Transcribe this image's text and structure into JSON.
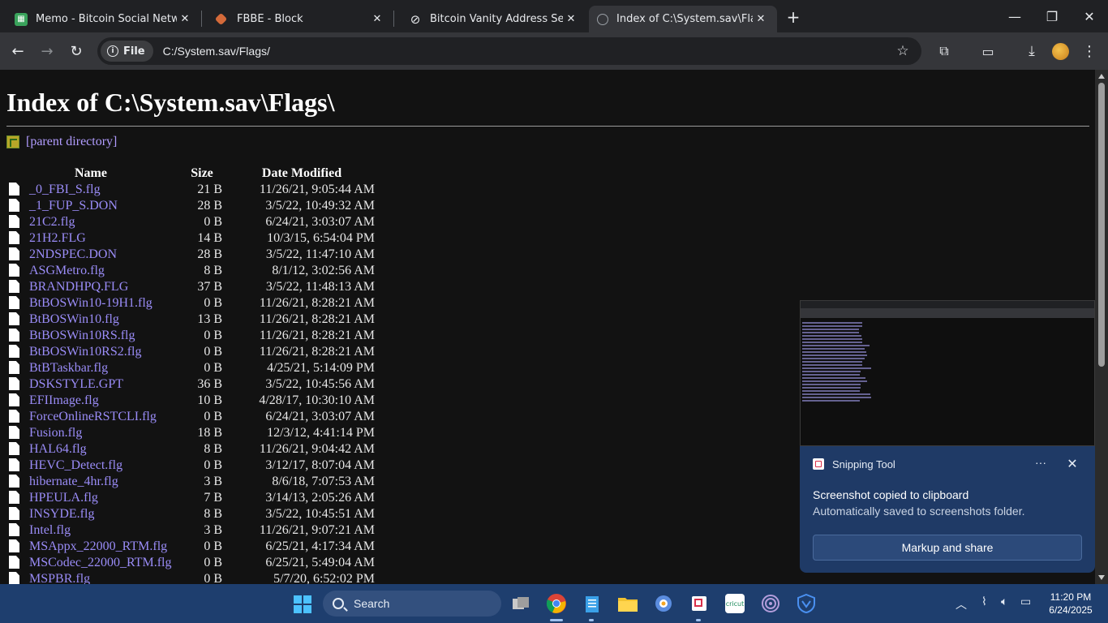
{
  "tabs": [
    {
      "title": "Memo - Bitcoin Social Network",
      "favicon": "memo-icon",
      "color": "#3aa35c"
    },
    {
      "title": "FBBE - Block",
      "favicon": "fbbe-icon",
      "color": "#d46a3a"
    },
    {
      "title": "Bitcoin Vanity Address Security",
      "favicon": "no-symbol-icon",
      "color": "#e8eaed"
    },
    {
      "title": "Index of C:\\System.sav\\Flags\\",
      "favicon": "globe-icon",
      "color": "#9aa0a6"
    }
  ],
  "address": {
    "chip_label": "File",
    "url": "C:/System.sav/Flags/"
  },
  "page": {
    "heading": "Index of C:\\System.sav\\Flags\\",
    "parent_link": "[parent directory]",
    "columns": {
      "name": "Name",
      "size": "Size",
      "date": "Date Modified"
    },
    "files": [
      {
        "name": "_0_FBI_S.flg",
        "size": "21 B",
        "date": "11/26/21, 9:05:44 AM"
      },
      {
        "name": "_1_FUP_S.DON",
        "size": "28 B",
        "date": "3/5/22, 10:49:32 AM"
      },
      {
        "name": "21C2.flg",
        "size": "0 B",
        "date": "6/24/21, 3:03:07 AM"
      },
      {
        "name": "21H2.FLG",
        "size": "14 B",
        "date": "10/3/15, 6:54:04 PM"
      },
      {
        "name": "2NDSPEC.DON",
        "size": "28 B",
        "date": "3/5/22, 11:47:10 AM"
      },
      {
        "name": "ASGMetro.flg",
        "size": "8 B",
        "date": "8/1/12, 3:02:56 AM"
      },
      {
        "name": "BRANDHPQ.FLG",
        "size": "37 B",
        "date": "3/5/22, 11:48:13 AM"
      },
      {
        "name": "BtBOSWin10-19H1.flg",
        "size": "0 B",
        "date": "11/26/21, 8:28:21 AM"
      },
      {
        "name": "BtBOSWin10.flg",
        "size": "13 B",
        "date": "11/26/21, 8:28:21 AM"
      },
      {
        "name": "BtBOSWin10RS.flg",
        "size": "0 B",
        "date": "11/26/21, 8:28:21 AM"
      },
      {
        "name": "BtBOSWin10RS2.flg",
        "size": "0 B",
        "date": "11/26/21, 8:28:21 AM"
      },
      {
        "name": "BtBTaskbar.flg",
        "size": "0 B",
        "date": "4/25/21, 5:14:09 PM"
      },
      {
        "name": "DSKSTYLE.GPT",
        "size": "36 B",
        "date": "3/5/22, 10:45:56 AM"
      },
      {
        "name": "EFIImage.flg",
        "size": "10 B",
        "date": "4/28/17, 10:30:10 AM"
      },
      {
        "name": "ForceOnlineRSTCLI.flg",
        "size": "0 B",
        "date": "6/24/21, 3:03:07 AM"
      },
      {
        "name": "Fusion.flg",
        "size": "18 B",
        "date": "12/3/12, 4:41:14 PM"
      },
      {
        "name": "HAL64.flg",
        "size": "8 B",
        "date": "11/26/21, 9:04:42 AM"
      },
      {
        "name": "HEVC_Detect.flg",
        "size": "0 B",
        "date": "3/12/17, 8:07:04 AM"
      },
      {
        "name": "hibernate_4hr.flg",
        "size": "3 B",
        "date": "8/6/18, 7:07:53 AM"
      },
      {
        "name": "HPEULA.flg",
        "size": "7 B",
        "date": "3/14/13, 2:05:26 AM"
      },
      {
        "name": "INSYDE.flg",
        "size": "8 B",
        "date": "3/5/22, 10:45:51 AM"
      },
      {
        "name": "Intel.flg",
        "size": "3 B",
        "date": "11/26/21, 9:07:21 AM"
      },
      {
        "name": "MSAppx_22000_RTM.flg",
        "size": "0 B",
        "date": "6/25/21, 4:17:34 AM"
      },
      {
        "name": "MSCodec_22000_RTM.flg",
        "size": "0 B",
        "date": "6/25/21, 5:49:04 AM"
      },
      {
        "name": "MSPBR.flg",
        "size": "0 B",
        "date": "5/7/20, 6:52:02 PM"
      }
    ]
  },
  "toast": {
    "app": "Snipping Tool",
    "more": "···",
    "heading": "Screenshot copied to clipboard",
    "body": "Automatically saved to screenshots folder.",
    "button": "Markup and share"
  },
  "taskbar": {
    "search_label": "Search",
    "time": "11:20 PM",
    "date": "6/24/2025"
  },
  "colors": {
    "page_bg": "#121212",
    "link": "#9a8cf7",
    "toast_bg": "#1f3a66",
    "taskbar_bg": "#1e3e6e"
  }
}
